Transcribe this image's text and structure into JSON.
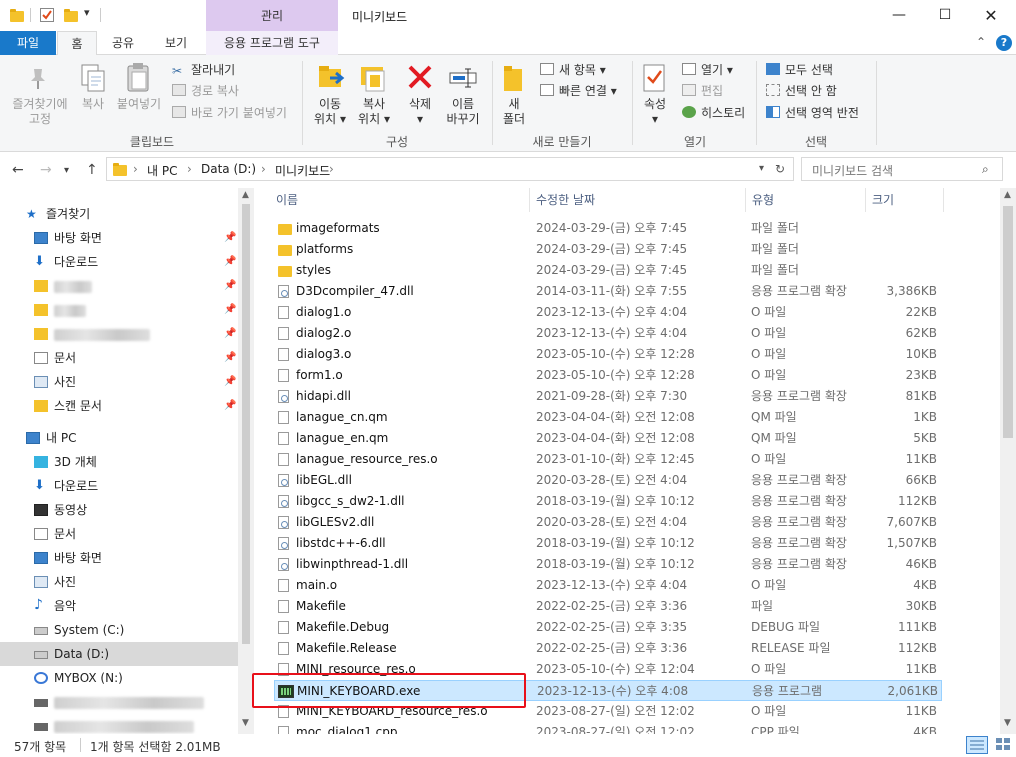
{
  "window": {
    "manage_tab": "관리",
    "title": "미니키보드"
  },
  "ribbon_tabs": [
    "파일",
    "홈",
    "공유",
    "보기",
    "응용 프로그램 도구"
  ],
  "ribbon": {
    "clipboard": {
      "pin_label_1": "즐겨찾기에",
      "pin_label_2": "고정",
      "copy": "복사",
      "paste": "붙여넣기",
      "cut": "잘라내기",
      "copy_path": "경로 복사",
      "paste_shortcut": "바로 가기 붙여넣기",
      "group": "클립보드"
    },
    "organize": {
      "move_1": "이동",
      "move_2": "위치",
      "copy_1": "복사",
      "copy_2": "위치",
      "delete": "삭제",
      "rename_1": "이름",
      "rename_2": "바꾸기",
      "group": "구성"
    },
    "new": {
      "new_folder_1": "새",
      "new_folder_2": "폴더",
      "new_item": "새 항목",
      "easy_access": "빠른 연결",
      "group": "새로 만들기"
    },
    "open": {
      "properties": "속성",
      "open": "열기",
      "edit": "편집",
      "history": "히스토리",
      "group": "열기"
    },
    "select": {
      "select_all": "모두 선택",
      "select_none": "선택 안 함",
      "invert": "선택 영역 반전",
      "group": "선택"
    }
  },
  "address": {
    "crumbs": [
      "내 PC",
      "Data (D:)",
      "미니키보드"
    ],
    "search_placeholder": "미니키보드 검색"
  },
  "nav": {
    "quick_access": "즐겨찾기",
    "quick_items": [
      "바탕 화면",
      "다운로드",
      "문서",
      "사진",
      "스캔 문서"
    ],
    "this_pc": "내 PC",
    "pc_items": [
      "3D 개체",
      "다운로드",
      "동영상",
      "문서",
      "바탕 화면",
      "사진",
      "음악",
      "System (C:)",
      "Data (D:)",
      "MYBOX (N:)"
    ]
  },
  "columns": {
    "name": "이름",
    "date": "수정한 날짜",
    "type": "유형",
    "size": "크기"
  },
  "files": [
    {
      "name": "imageformats",
      "date": "2024-03-29-(금) 오후 7:45",
      "type": "파일 폴더",
      "size": "",
      "icon": "folder"
    },
    {
      "name": "platforms",
      "date": "2024-03-29-(금) 오후 7:45",
      "type": "파일 폴더",
      "size": "",
      "icon": "folder"
    },
    {
      "name": "styles",
      "date": "2024-03-29-(금) 오후 7:45",
      "type": "파일 폴더",
      "size": "",
      "icon": "folder"
    },
    {
      "name": "D3Dcompiler_47.dll",
      "date": "2014-03-11-(화) 오후 7:55",
      "type": "응용 프로그램 확장",
      "size": "3,386KB",
      "icon": "dll"
    },
    {
      "name": "dialog1.o",
      "date": "2023-12-13-(수) 오후 4:04",
      "type": "O 파일",
      "size": "22KB",
      "icon": "doc"
    },
    {
      "name": "dialog2.o",
      "date": "2023-12-13-(수) 오후 4:04",
      "type": "O 파일",
      "size": "62KB",
      "icon": "doc"
    },
    {
      "name": "dialog3.o",
      "date": "2023-05-10-(수) 오후 12:28",
      "type": "O 파일",
      "size": "10KB",
      "icon": "doc"
    },
    {
      "name": "form1.o",
      "date": "2023-05-10-(수) 오후 12:28",
      "type": "O 파일",
      "size": "23KB",
      "icon": "doc"
    },
    {
      "name": "hidapi.dll",
      "date": "2021-09-28-(화) 오후 7:30",
      "type": "응용 프로그램 확장",
      "size": "81KB",
      "icon": "dll"
    },
    {
      "name": "lanague_cn.qm",
      "date": "2023-04-04-(화) 오전 12:08",
      "type": "QM 파일",
      "size": "1KB",
      "icon": "doc"
    },
    {
      "name": "lanague_en.qm",
      "date": "2023-04-04-(화) 오전 12:08",
      "type": "QM 파일",
      "size": "5KB",
      "icon": "doc"
    },
    {
      "name": "lanague_resource_res.o",
      "date": "2023-01-10-(화) 오후 12:45",
      "type": "O 파일",
      "size": "11KB",
      "icon": "doc"
    },
    {
      "name": "libEGL.dll",
      "date": "2020-03-28-(토) 오전 4:04",
      "type": "응용 프로그램 확장",
      "size": "66KB",
      "icon": "dll"
    },
    {
      "name": "libgcc_s_dw2-1.dll",
      "date": "2018-03-19-(월) 오후 10:12",
      "type": "응용 프로그램 확장",
      "size": "112KB",
      "icon": "dll"
    },
    {
      "name": "libGLESv2.dll",
      "date": "2020-03-28-(토) 오전 4:04",
      "type": "응용 프로그램 확장",
      "size": "7,607KB",
      "icon": "dll"
    },
    {
      "name": "libstdc++-6.dll",
      "date": "2018-03-19-(월) 오후 10:12",
      "type": "응용 프로그램 확장",
      "size": "1,507KB",
      "icon": "dll"
    },
    {
      "name": "libwinpthread-1.dll",
      "date": "2018-03-19-(월) 오후 10:12",
      "type": "응용 프로그램 확장",
      "size": "46KB",
      "icon": "dll"
    },
    {
      "name": "main.o",
      "date": "2023-12-13-(수) 오후 4:04",
      "type": "O 파일",
      "size": "4KB",
      "icon": "doc"
    },
    {
      "name": "Makefile",
      "date": "2022-02-25-(금) 오후 3:36",
      "type": "파일",
      "size": "30KB",
      "icon": "doc"
    },
    {
      "name": "Makefile.Debug",
      "date": "2022-02-25-(금) 오후 3:35",
      "type": "DEBUG 파일",
      "size": "111KB",
      "icon": "doc"
    },
    {
      "name": "Makefile.Release",
      "date": "2022-02-25-(금) 오후 3:36",
      "type": "RELEASE 파일",
      "size": "112KB",
      "icon": "doc"
    },
    {
      "name": "MINI_resource_res.o",
      "date": "2023-05-10-(수) 오후 12:04",
      "type": "O 파일",
      "size": "11KB",
      "icon": "doc"
    },
    {
      "name": "MINI_KEYBOARD.exe",
      "date": "2023-12-13-(수) 오후 4:08",
      "type": "응용 프로그램",
      "size": "2,061KB",
      "icon": "exe",
      "selected": true
    },
    {
      "name": "MINI_KEYBOARD_resource_res.o",
      "date": "2023-08-27-(일) 오전 12:02",
      "type": "O 파일",
      "size": "11KB",
      "icon": "doc"
    },
    {
      "name": "moc_dialog1.cpp",
      "date": "2023-08-27-(일) 오전 12:02",
      "type": "CPP 파일",
      "size": "4KB",
      "icon": "doc"
    }
  ],
  "status": {
    "count": "57개 항목",
    "selection": "1개 항목 선택함 2.01MB"
  }
}
